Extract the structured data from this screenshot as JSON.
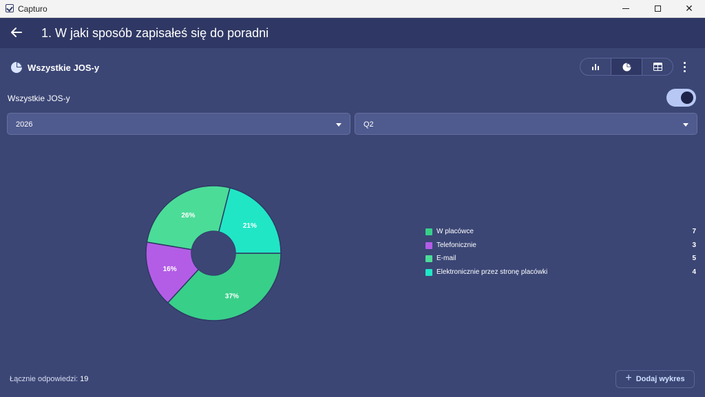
{
  "window": {
    "title": "Capturo"
  },
  "header": {
    "title": "1. W jaki sposób zapisałeś się do poradni"
  },
  "card": {
    "title": "Wszystkie JOS-y"
  },
  "filter": {
    "label": "Wszystkie JOS-y",
    "toggle_on": true
  },
  "selects": {
    "year": "2026",
    "quarter": "Q2"
  },
  "colors": {
    "W placówce": "#3ecf8e",
    "Telefonicznie": "#b35de6",
    "E-mail": "#4ddc98",
    "Elektronicznie przez stronę placówki": "#1fe6c4"
  },
  "chart_data": {
    "type": "pie",
    "donut": true,
    "categories": [
      "W placówce",
      "Telefonicznie",
      "E-mail",
      "Elektronicznie przez stronę placówki"
    ],
    "values": [
      7,
      3,
      5,
      4
    ],
    "percent_labels": [
      "37%",
      "16%",
      "26%",
      "21%"
    ],
    "colors": [
      "#38cf89",
      "#b35de6",
      "#4bdc98",
      "#20e6c5"
    ],
    "legend_position": "right"
  },
  "footer": {
    "total_label": "Łącznie odpowiedzi:",
    "total_value": "19",
    "add_button": "Dodaj wykres"
  }
}
